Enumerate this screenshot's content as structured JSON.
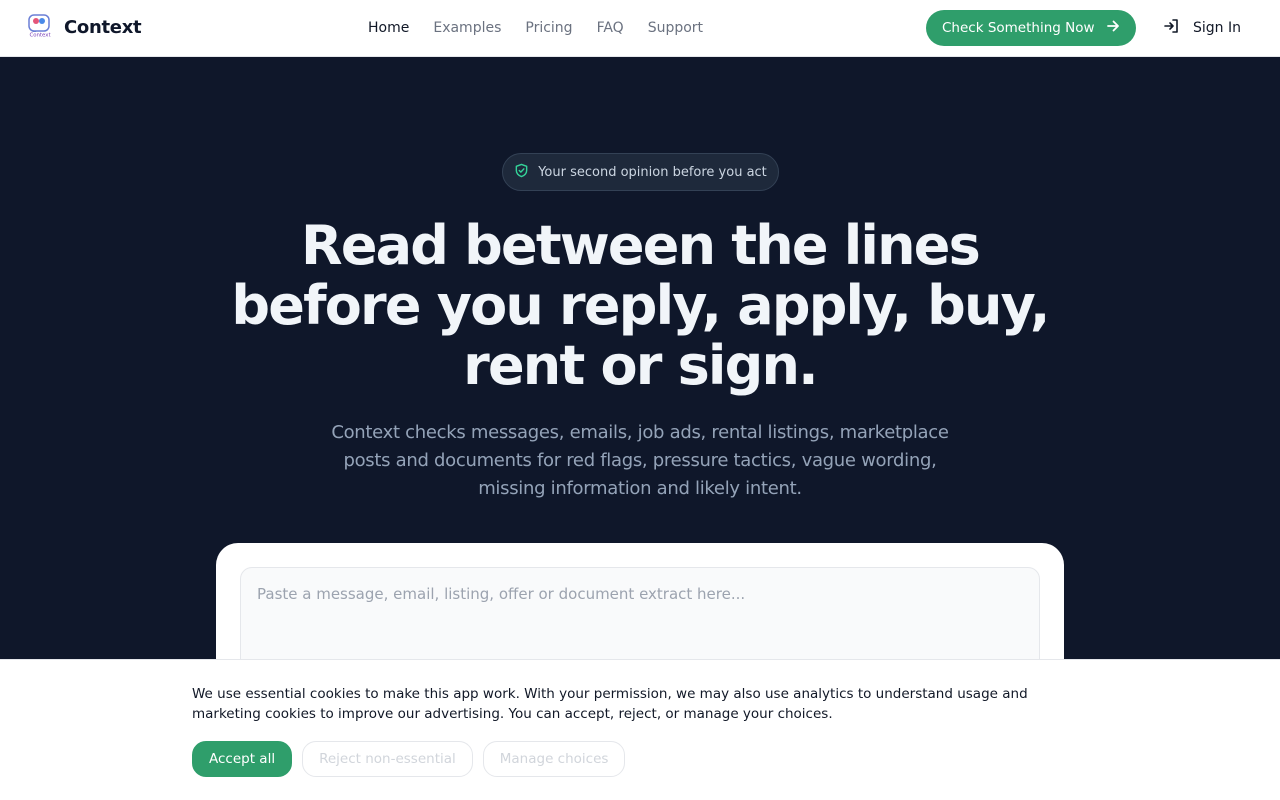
{
  "brand": {
    "name": "Context",
    "logo_text": "Context"
  },
  "nav": {
    "items": [
      {
        "label": "Home",
        "active": true
      },
      {
        "label": "Examples"
      },
      {
        "label": "Pricing"
      },
      {
        "label": "FAQ"
      },
      {
        "label": "Support"
      }
    ]
  },
  "header": {
    "cta_label": "Check Something Now",
    "cta_icon": "arrow-right-icon",
    "signin_label": "Sign In",
    "signin_icon": "log-in-icon"
  },
  "hero": {
    "badge_icon": "shield-check-icon",
    "badge_text": "Your second opinion before you act",
    "title": "Read between the lines before you reply, apply, buy, rent or sign.",
    "subtitle": "Context checks messages, emails, job ads, rental listings, marketplace posts and documents for red flags, pressure tactics, vague wording, missing information and likely intent."
  },
  "checker": {
    "value": "",
    "placeholder": "Paste a message, email, listing, offer or document extract here..."
  },
  "cookie_banner": {
    "text": "We use essential cookies to make this app work. With your permission, we may also use analytics to understand usage and marketing cookies to improve our advertising. You can accept, reject, or manage your choices.",
    "accept_label": "Accept all",
    "reject_label": "Reject non-essential",
    "manage_label": "Manage choices"
  },
  "colors": {
    "accent": "#2f9e6b",
    "hero_bg": "#0f172a",
    "text_dark": "#111827"
  }
}
